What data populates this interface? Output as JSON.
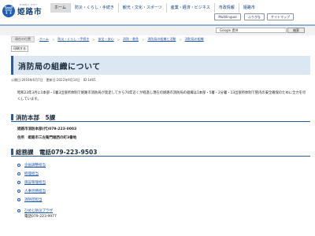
{
  "header": {
    "logo_mark": "⛩",
    "logo_sub": "HIMEJI CITY",
    "logo_text": "姫路市",
    "nav": [
      "ホーム",
      "防災・くらし・手続き",
      "観光・文化・スポーツ",
      "産業・経済・ビジネス",
      "市政情報",
      "姫路市"
    ],
    "util": {
      "multilingual": "Multilingual",
      "yomigana": "ふりがな",
      "sitemap": "サイトマップ"
    }
  },
  "search": {
    "placeholder": "Google 提供",
    "button": "検索"
  },
  "breadcrumb": {
    "label": "現在の位置",
    "items": [
      "ホーム",
      "防災・くらし・手続き",
      "安全・安心",
      "消防・救急",
      "消防局の組織と活動",
      "消防局の組織"
    ]
  },
  "print_label": "印刷する",
  "page": {
    "title": "消防局の組織について",
    "dates": "公開日:2016年6月7日　更新日:2022年9月14日　ID:1465",
    "intro": "昭和23年3月に1本部・1署3出張所体制で姫路市消防局が発足してから70年近くが経過し現在の姫路市消防局の組織は1本部・5署・2分署・13出張所体制で管内の安全確保のために全力を尽くしています。"
  },
  "hq": {
    "heading": "消防本部　5課",
    "name_label": "姫路市消防本部(代)079-223-0003",
    "address": "住所　姫路市三左衛門堀西の町3番地"
  },
  "general": {
    "heading": "総務課　電話079-223-9503",
    "departments": [
      "企画調整担当",
      "経理担当",
      "施設管理担当",
      "人事労務担当",
      "消防団担当"
    ],
    "plaza_link": "ひめじ防災プラザ",
    "plaza_phone": "電話079-223-9977"
  },
  "colors": {
    "accent": "#2b5c95",
    "title_bg": "#dbe7f2",
    "link": "#1a54a8"
  }
}
